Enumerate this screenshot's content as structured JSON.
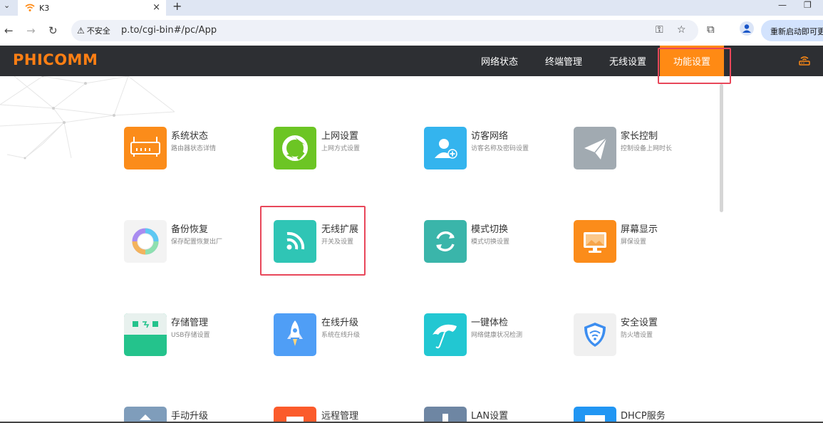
{
  "browser": {
    "tab_title": "K3",
    "url": "p.to/cgi-bin#/pc/App",
    "security_label": "不安全",
    "restart_label": "重新启动即可更新",
    "new_tab": "+",
    "tab_close": "×"
  },
  "header": {
    "logo": "PHICOMM",
    "nav": [
      {
        "label": "网络状态"
      },
      {
        "label": "终端管理"
      },
      {
        "label": "无线设置"
      },
      {
        "label": "功能设置",
        "active": true
      }
    ]
  },
  "apps": [
    {
      "title": "系统状态",
      "subtitle": "路由器状态详情",
      "icon": "router-icon",
      "color": "#fb8c1a"
    },
    {
      "title": "上网设置",
      "subtitle": "上网方式设置",
      "icon": "internet-icon",
      "color": "#6cc524"
    },
    {
      "title": "访客网络",
      "subtitle": "访客名称及密码设置",
      "icon": "add-user-icon",
      "color": "#34b4ee"
    },
    {
      "title": "家长控制",
      "subtitle": "控制设备上网时长",
      "icon": "paper-plane-icon",
      "color": "#a1aab1"
    },
    {
      "title": "备份恢复",
      "subtitle": "保存配置恢复出厂",
      "icon": "backup-ring-icon",
      "color": "#f3f3f3"
    },
    {
      "title": "无线扩展",
      "subtitle": "开关及设置",
      "icon": "wireless-extend-icon",
      "color": "#2fc5b5"
    },
    {
      "title": "模式切换",
      "subtitle": "模式切换设置",
      "icon": "mode-switch-icon",
      "color": "#3ab5aa"
    },
    {
      "title": "屏幕显示",
      "subtitle": "屏保设置",
      "icon": "screen-icon",
      "color": "#fb8c1a"
    },
    {
      "title": "存储管理",
      "subtitle": "USB存储设置",
      "icon": "usb-storage-icon",
      "color": "#24c38c"
    },
    {
      "title": "在线升级",
      "subtitle": "系统在线升级",
      "icon": "rocket-icon",
      "color": "#4f9ef6"
    },
    {
      "title": "一键体检",
      "subtitle": "网络健康状况检测",
      "icon": "umbrella-icon",
      "color": "#22c7d2"
    },
    {
      "title": "安全设置",
      "subtitle": "防火墙设置",
      "icon": "shield-wifi-icon",
      "color": "#f0f0f0"
    },
    {
      "title": "手动升级",
      "subtitle": "",
      "icon": "manual-upgrade-icon",
      "color": "#7f9dbb"
    },
    {
      "title": "远程管理",
      "subtitle": "",
      "icon": "remote-manage-icon",
      "color": "#fb5b2b"
    },
    {
      "title": "LAN设置",
      "subtitle": "",
      "icon": "lan-icon",
      "color": "#6e86a3"
    },
    {
      "title": "DHCP服务",
      "subtitle": "",
      "icon": "dhcp-icon",
      "color": "#2196f3"
    }
  ],
  "colors": {
    "accent": "#ff8a14",
    "header_bg": "#2d2f33",
    "highlight_border": "#e8475a"
  }
}
